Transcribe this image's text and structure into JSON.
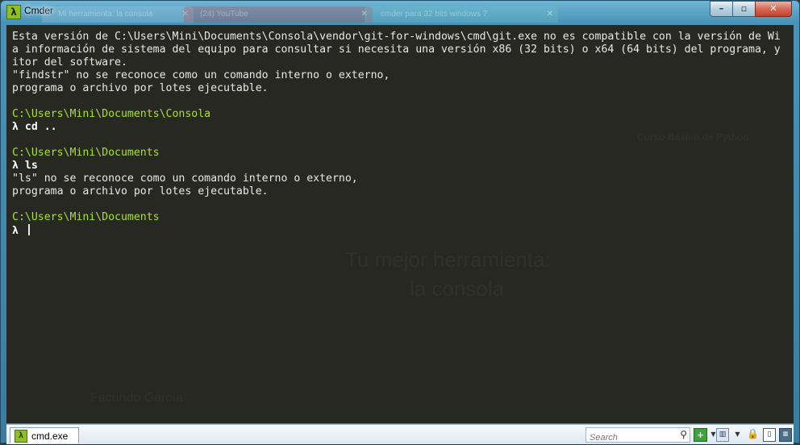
{
  "window": {
    "title": "Cmder",
    "background_tabs": [
      "Mi herramienta: la consola",
      "(24) YouTube",
      "cmder para 32 bits windows 7"
    ]
  },
  "controls": {
    "minimize": "–",
    "maximize": "▫",
    "close": "✕"
  },
  "terminal": {
    "lines": [
      "Esta versión de C:\\Users\\Mini\\Documents\\Consola\\vendor\\git-for-windows\\cmd\\git.exe no es compatible con la versión de Wi",
      "a información de sistema del equipo para consultar si necesita una versión x86 (32 bits) o x64 (64 bits) del programa, y",
      "itor del software.",
      "\"findstr\" no se reconoce como un comando interno o externo,",
      "programa o archivo por lotes ejecutable.",
      "",
      "C:\\Users\\Mini\\Documents\\Consola",
      "λ cd ..",
      "",
      "C:\\Users\\Mini\\Documents",
      "λ ls",
      "\"ls\" no se reconoce como un comando interno o externo,",
      "programa o archivo por lotes ejecutable.",
      "",
      "C:\\Users\\Mini\\Documents",
      "λ "
    ]
  },
  "background_ghost": {
    "heading_line1": "Tu mejor herramienta:",
    "heading_line2": "la consola",
    "course": "Curso Básico de Python",
    "presenter": "Facundo García"
  },
  "statusbar": {
    "console_tab_label": "cmd.exe",
    "search_placeholder": "Search"
  },
  "colors": {
    "console_bg": "#272822",
    "path_green": "#a6e22e",
    "text": "#e8e8e8"
  }
}
